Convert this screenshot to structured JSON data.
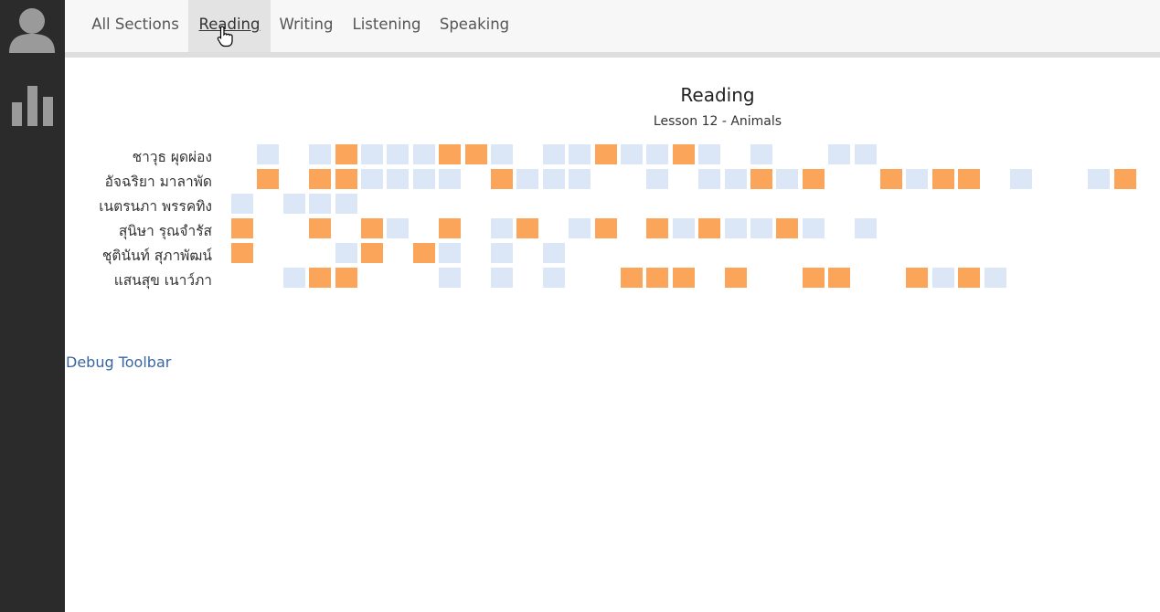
{
  "sidebar": {
    "items": [
      {
        "name": "avatar-icon"
      },
      {
        "name": "bar-chart-icon"
      }
    ]
  },
  "nav": {
    "tabs": [
      {
        "label": "All Sections",
        "active": false
      },
      {
        "label": "Reading",
        "active": true
      },
      {
        "label": "Writing",
        "active": false
      },
      {
        "label": "Listening",
        "active": false
      },
      {
        "label": "Speaking",
        "active": false
      }
    ]
  },
  "chart": {
    "title": "Reading",
    "subtitle": "Lesson 12 - Animals"
  },
  "colors": {
    "sidebar_bg": "#2b2b2b",
    "nav_bg": "#f7f7f7",
    "cell_light": "#dbe7f6",
    "cell_orange": "#fba55a",
    "link": "#3a66a0"
  },
  "chart_data": {
    "type": "heatmap",
    "title": "Reading",
    "subtitle": "Lesson 12 - Animals",
    "legend": "none",
    "value_key": {
      "0": "light blue",
      "1": "orange",
      "null": "empty"
    },
    "rows": [
      {
        "name": "ชาวุธ ผุดผ่อง",
        "cells": [
          null,
          0,
          null,
          0,
          1,
          0,
          0,
          0,
          1,
          1,
          0,
          null,
          0,
          0,
          1,
          0,
          0,
          1,
          0,
          null,
          0,
          null,
          null,
          0,
          0,
          null,
          null,
          null,
          null,
          null,
          null,
          null,
          null,
          null
        ]
      },
      {
        "name": "อัจฉริยา มาลาพัด",
        "cells": [
          null,
          1,
          null,
          1,
          1,
          0,
          0,
          0,
          0,
          null,
          1,
          0,
          0,
          0,
          null,
          null,
          0,
          null,
          0,
          0,
          1,
          0,
          1,
          null,
          null,
          1,
          0,
          1,
          1,
          null,
          0,
          null,
          null,
          0,
          1
        ]
      },
      {
        "name": "เนตรนภา พรรคทิง",
        "cells": [
          0,
          null,
          0,
          0,
          0,
          null,
          null,
          null,
          null,
          null,
          null,
          null,
          null,
          null,
          null,
          null,
          null,
          null,
          null,
          null,
          null,
          null,
          null,
          null,
          null,
          null,
          null,
          null,
          null,
          null,
          null,
          null,
          null,
          null,
          null
        ]
      },
      {
        "name": "สุนิษา รุณจำรัส",
        "cells": [
          1,
          null,
          null,
          1,
          null,
          1,
          0,
          null,
          1,
          null,
          0,
          1,
          null,
          0,
          1,
          null,
          1,
          0,
          1,
          0,
          0,
          1,
          0,
          null,
          0,
          null,
          null,
          null,
          null,
          null,
          null,
          null,
          null,
          null,
          null
        ]
      },
      {
        "name": "ชุตินันท์ สุภาพัฒน์",
        "cells": [
          1,
          null,
          null,
          null,
          0,
          1,
          null,
          1,
          0,
          null,
          0,
          null,
          0,
          null,
          null,
          null,
          null,
          null,
          null,
          null,
          null,
          null,
          null,
          null,
          null,
          null,
          null,
          null,
          null,
          null,
          null,
          null,
          null,
          null,
          null
        ]
      },
      {
        "name": "แสนสุข เนาว์ภา",
        "cells": [
          null,
          null,
          0,
          1,
          1,
          null,
          null,
          null,
          0,
          null,
          0,
          null,
          0,
          null,
          null,
          1,
          1,
          1,
          null,
          1,
          null,
          null,
          1,
          1,
          null,
          null,
          1,
          0,
          1,
          0,
          null,
          null,
          null,
          null,
          null
        ]
      }
    ]
  },
  "footer": {
    "debug_label": "Debug Toolbar"
  }
}
